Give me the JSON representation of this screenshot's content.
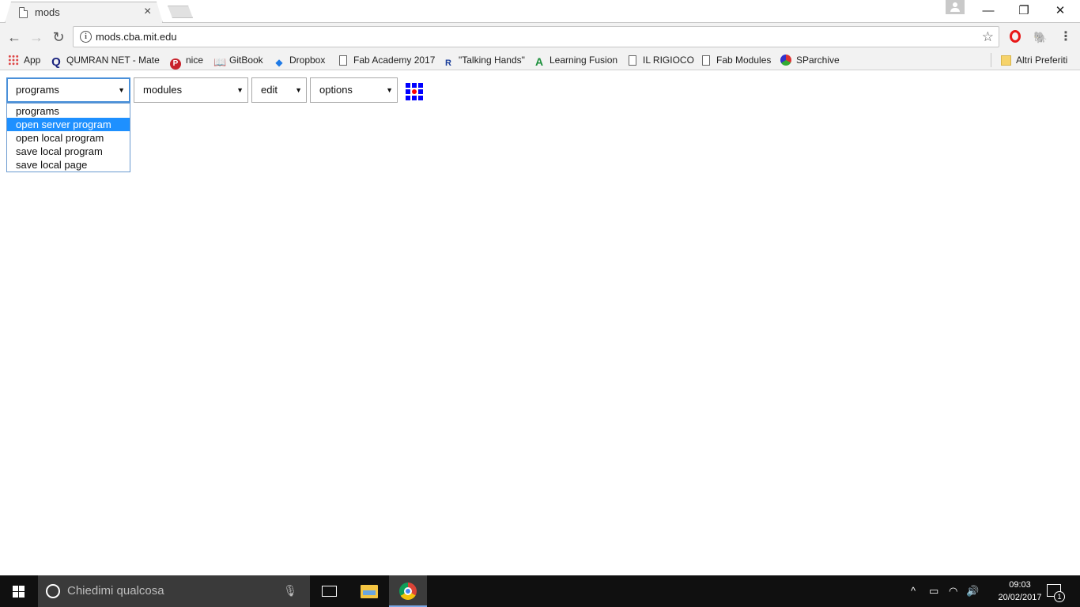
{
  "browser": {
    "tab_title": "mods",
    "tab_close": "×",
    "url": "mods.cba.mit.edu",
    "window_controls": {
      "minimize": "—",
      "restore": "❐",
      "close": "✕"
    }
  },
  "bookmarks": [
    {
      "label": "App",
      "icon": "apps-grid-icon"
    },
    {
      "label": "QUMRAN NET - Mate",
      "icon": "qumran-icon"
    },
    {
      "label": "nice",
      "icon": "pinterest-icon"
    },
    {
      "label": "GitBook",
      "icon": "gitbook-icon"
    },
    {
      "label": "Dropbox",
      "icon": "dropbox-icon"
    },
    {
      "label": "Fab Academy 2017",
      "icon": "page-icon"
    },
    {
      "label": "\"Talking Hands\"",
      "icon": "researchgate-icon"
    },
    {
      "label": "Learning Fusion",
      "icon": "autodesk-icon"
    },
    {
      "label": "IL RIGIOCO",
      "icon": "page-icon"
    },
    {
      "label": "Fab Modules",
      "icon": "page-icon"
    },
    {
      "label": "SParchive",
      "icon": "sparchive-icon"
    }
  ],
  "other_bookmarks": "Altri Preferiti",
  "menus": {
    "programs": "programs",
    "modules": "modules",
    "edit": "edit",
    "options": "options"
  },
  "programs_dropdown": {
    "selected_index": 1,
    "options": [
      "programs",
      "open server program",
      "open local program",
      "save local program",
      "save local page"
    ]
  },
  "taskbar": {
    "search_placeholder": "Chiedimi qualcosa",
    "time": "09:03",
    "date": "20/02/2017",
    "notification_count": "1"
  },
  "colors": {
    "accent_blue": "#1e90ff",
    "grid_blue": "#0000ff",
    "grid_red": "#ff0000"
  }
}
